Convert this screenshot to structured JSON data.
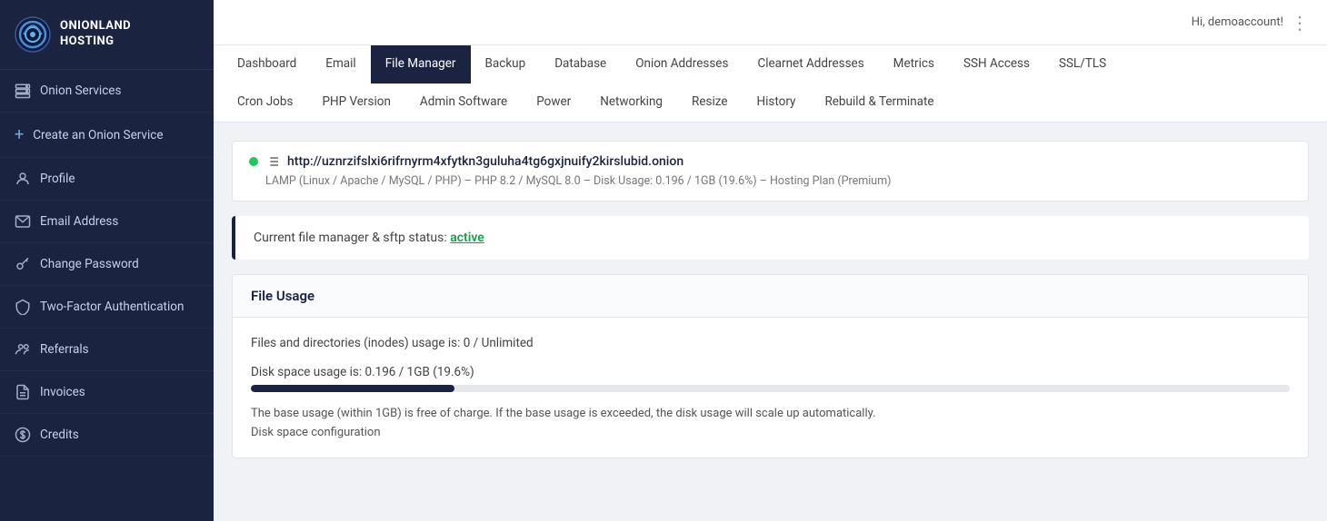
{
  "brand": {
    "name_line1": "ONIONLAND",
    "name_line2": "HOSTING"
  },
  "topbar": {
    "greeting": "Hi, demoaccount!",
    "dots": "⋮"
  },
  "sidebar": {
    "items": [
      {
        "id": "onion-services",
        "label": "Onion Services",
        "icon": "server"
      },
      {
        "id": "create-onion-service",
        "label": "Create an Onion Service",
        "icon": "plus"
      },
      {
        "id": "profile",
        "label": "Profile",
        "icon": "user"
      },
      {
        "id": "email-address",
        "label": "Email Address",
        "icon": "email"
      },
      {
        "id": "change-password",
        "label": "Change Password",
        "icon": "key"
      },
      {
        "id": "two-factor",
        "label": "Two-Factor Authentication",
        "icon": "shield"
      },
      {
        "id": "referrals",
        "label": "Referrals",
        "icon": "users"
      },
      {
        "id": "invoices",
        "label": "Invoices",
        "icon": "document"
      },
      {
        "id": "credits",
        "label": "Credits",
        "icon": "dollar"
      }
    ]
  },
  "tabs_row1": [
    {
      "id": "dashboard",
      "label": "Dashboard",
      "active": false
    },
    {
      "id": "email",
      "label": "Email",
      "active": false
    },
    {
      "id": "file-manager",
      "label": "File Manager",
      "active": true
    },
    {
      "id": "backup",
      "label": "Backup",
      "active": false
    },
    {
      "id": "database",
      "label": "Database",
      "active": false
    },
    {
      "id": "onion-addresses",
      "label": "Onion Addresses",
      "active": false
    },
    {
      "id": "clearnet-addresses",
      "label": "Clearnet Addresses",
      "active": false
    },
    {
      "id": "metrics",
      "label": "Metrics",
      "active": false
    },
    {
      "id": "ssh-access",
      "label": "SSH Access",
      "active": false
    },
    {
      "id": "ssl-tls",
      "label": "SSL/TLS",
      "active": false
    }
  ],
  "tabs_row2": [
    {
      "id": "cron-jobs",
      "label": "Cron Jobs",
      "active": false
    },
    {
      "id": "php-version",
      "label": "PHP Version",
      "active": false
    },
    {
      "id": "admin-software",
      "label": "Admin Software",
      "active": false
    },
    {
      "id": "power",
      "label": "Power",
      "active": false
    },
    {
      "id": "networking",
      "label": "Networking",
      "active": false
    },
    {
      "id": "resize",
      "label": "Resize",
      "active": false
    },
    {
      "id": "history",
      "label": "History",
      "active": false
    },
    {
      "id": "rebuild-terminate",
      "label": "Rebuild & Terminate",
      "active": false
    }
  ],
  "service": {
    "url": "http://uznrzifslxi6rifrnyrm4xfytkn3guluha4tg6gxjnuify2kirslubid.onion",
    "meta": "LAMP (Linux / Apache / MySQL / PHP) – PHP 8.2 / MySQL 8.0 – Disk Usage: 0.196 / 1GB (19.6%) – Hosting Plan (Premium)"
  },
  "alert": {
    "text": "Current file manager & sftp status: ",
    "status": "active"
  },
  "file_usage": {
    "title": "File Usage",
    "inodes_label": "Files and directories (inodes) usage is: ",
    "inodes_value": "0 / Unlimited",
    "disk_label": "Disk space usage is: ",
    "disk_value": "0.196 / 1GB (19.6%)",
    "disk_percent": 19.6,
    "note": "The base usage (within 1GB) is free of charge. If the base usage is exceeded, the disk usage will scale up automatically.",
    "subtext": "Disk space configuration"
  }
}
